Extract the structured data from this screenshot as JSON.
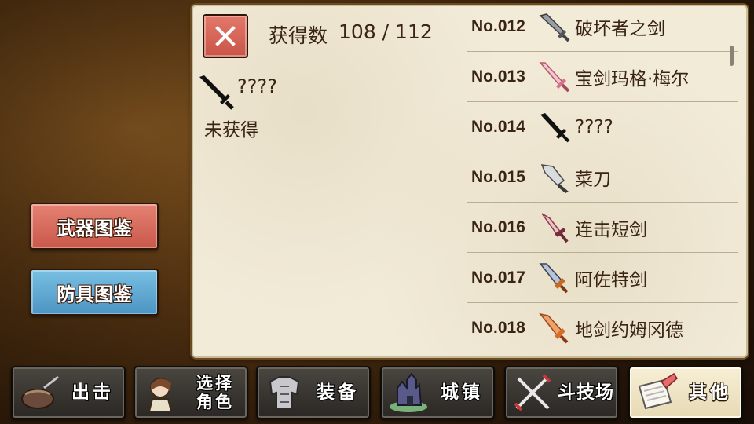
{
  "left_menu": {
    "weapons_label": "武器图鉴",
    "armor_label": "防具图鉴"
  },
  "panel": {
    "count_label": "获得数",
    "count_value": "108 / 112",
    "detail": {
      "name": "????",
      "status": "未获得",
      "icon": "black-sword-icon"
    },
    "list": [
      {
        "no": "No.012",
        "name": "破坏者之剑",
        "icon": "breaker-sword-icon"
      },
      {
        "no": "No.013",
        "name": "宝剑玛格·梅尔",
        "icon": "pink-sword-icon"
      },
      {
        "no": "No.014",
        "name": "????",
        "icon": "black-sword-icon"
      },
      {
        "no": "No.015",
        "name": "菜刀",
        "icon": "kitchen-knife-icon"
      },
      {
        "no": "No.016",
        "name": "连击短剑",
        "icon": "combo-dagger-icon"
      },
      {
        "no": "No.017",
        "name": "阿佐特剑",
        "icon": "azoth-sword-icon"
      },
      {
        "no": "No.018",
        "name": "地剑约姆冈德",
        "icon": "earth-sword-icon"
      }
    ]
  },
  "bottom_nav": [
    {
      "id": "sortie",
      "label": "出击",
      "icon": "pot-icon"
    },
    {
      "id": "select-char",
      "label_line1": "选择",
      "label_line2": "角色",
      "icon": "character-icon"
    },
    {
      "id": "equipment",
      "label": "装备",
      "icon": "armor-icon"
    },
    {
      "id": "town",
      "label": "城镇",
      "icon": "castle-icon"
    },
    {
      "id": "arena",
      "label": "斗技场",
      "icon": "crossed-swords-icon"
    },
    {
      "id": "other",
      "label": "其他",
      "icon": "scroll-icon",
      "active": true
    }
  ]
}
